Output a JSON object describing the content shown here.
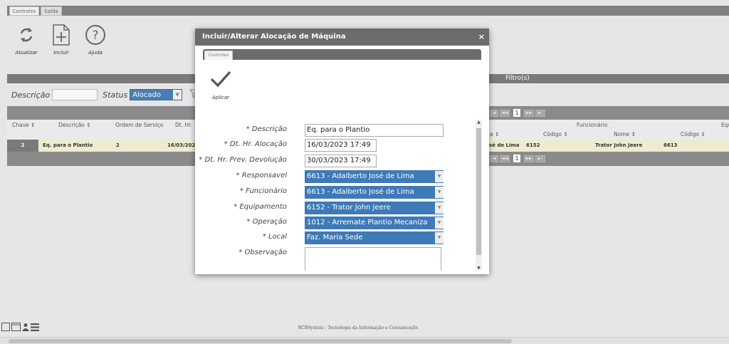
{
  "tabs": [
    {
      "label": "Controles"
    },
    {
      "label": "Saída"
    }
  ],
  "toolbar": {
    "refresh": "Atualizar",
    "add": "Incluir",
    "help": "Ajuda"
  },
  "filter": {
    "title": "Filtro(s)",
    "desc_label": "Descrição",
    "status_label": "Status",
    "status_value": "Alocado"
  },
  "grid": {
    "headers": {
      "chave": "Chave ⇕",
      "descricao": "Descrição ⇕",
      "ordem": "Ordem de Serviço",
      "dthr": "Dt. Hr.",
      "col_a": "a ⇕",
      "funcionario": "Funcionário",
      "func_codigo": "Código ⇕",
      "func_nome": "Nome ⇕",
      "equipamento": "Equipa",
      "equip_codigo": "Código ⇕"
    },
    "row": {
      "chave": "2",
      "descricao": "Eq. para o Plantio",
      "ordem": "2",
      "dthr": "16/03/202",
      "col_a": "sé de Lima",
      "func_codigo": "6152",
      "func_nome": "Trator John Jeere",
      "equip_codigo": "6613"
    },
    "page": "1"
  },
  "footer": {
    "text": "RCBSystem - Tecnologia da Informação e Comunicação"
  },
  "modal": {
    "title": "Incluir/Alterar Alocação de Máquina",
    "close": "×",
    "tab": "Controles",
    "apply_label": "Aplicar",
    "fields": {
      "descricao": {
        "label": "* Descrição",
        "value": "Eq. para o Plantio"
      },
      "dt_alocacao": {
        "label": "* Dt. Hr. Alocação",
        "value": "16/03/2023 17:49"
      },
      "dt_devolucao": {
        "label": "* Dt. Hr. Prev. Devolução",
        "value": "30/03/2023 17:49"
      },
      "responsavel": {
        "label": "* Responsavel",
        "value": "6613 - Adalberto José de Lima"
      },
      "funcionario": {
        "label": "* Funcionário",
        "value": "6613 - Adalberto José de Lima"
      },
      "equipamento": {
        "label": "* Equipamento",
        "value": "6152 - Trator John Jeere"
      },
      "operacao": {
        "label": "* Operação",
        "value": "1012 - Arremate Plantio Mecaniza"
      },
      "local": {
        "label": "* Local",
        "value": "Faz. Maria Sede"
      },
      "observacao": {
        "label": "* Observação",
        "value": ""
      }
    }
  },
  "colors": {
    "accent": "#3e7ab7",
    "header_gray": "#6c6c6c",
    "row_highlight": "#eeeccf"
  }
}
